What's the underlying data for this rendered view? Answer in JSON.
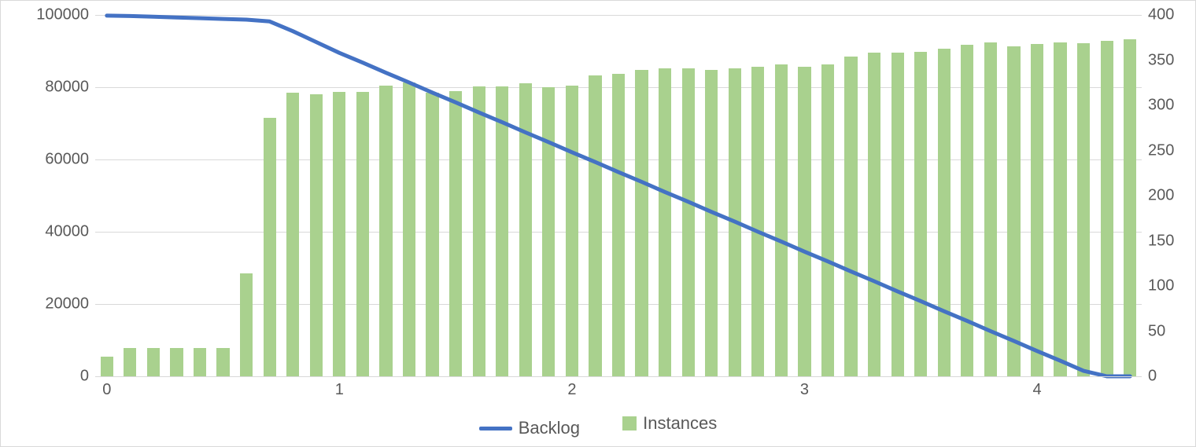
{
  "chart_data": {
    "type": "bar+line",
    "x": [
      0.0,
      0.1,
      0.2,
      0.3,
      0.4,
      0.5,
      0.6,
      0.7,
      0.8,
      0.9,
      1.0,
      1.1,
      1.2,
      1.3,
      1.4,
      1.5,
      1.6,
      1.7,
      1.8,
      1.9,
      2.0,
      2.1,
      2.2,
      2.3,
      2.4,
      2.5,
      2.6,
      2.7,
      2.8,
      2.9,
      3.0,
      3.1,
      3.2,
      3.3,
      3.4,
      3.5,
      3.6,
      3.7,
      3.8,
      3.9,
      4.0,
      4.1,
      4.2,
      4.3,
      4.4
    ],
    "series": [
      {
        "name": "Instances",
        "axis": "right",
        "type": "bar",
        "color": "#a9d18e",
        "values": [
          22,
          31,
          31,
          31,
          31,
          31,
          114,
          286,
          314,
          312,
          315,
          315,
          322,
          325,
          314,
          316,
          321,
          321,
          324,
          320,
          322,
          333,
          335,
          339,
          341,
          341,
          339,
          341,
          343,
          345,
          343,
          345,
          354,
          358,
          358,
          359,
          363,
          367,
          370,
          365,
          368,
          370,
          369,
          371,
          373,
          374,
          374
        ]
      },
      {
        "name": "Backlog",
        "axis": "left",
        "type": "line",
        "color": "#4472c4",
        "values": [
          99800,
          99700,
          99500,
          99300,
          99100,
          98900,
          98700,
          98200,
          95500,
          92500,
          89500,
          86800,
          84000,
          81300,
          78500,
          75800,
          73000,
          70300,
          67500,
          64800,
          62000,
          59300,
          56500,
          53800,
          51000,
          48300,
          45500,
          42800,
          40000,
          37300,
          34500,
          31800,
          29000,
          26300,
          23500,
          20800,
          18000,
          15300,
          12500,
          9800,
          7000,
          4300,
          1500,
          0,
          0
        ]
      }
    ],
    "y_left": {
      "min": 0,
      "max": 100000,
      "ticks": [
        0,
        20000,
        40000,
        60000,
        80000,
        100000
      ]
    },
    "y_right": {
      "min": 0,
      "max": 400,
      "ticks": [
        0,
        50,
        100,
        150,
        200,
        250,
        300,
        350,
        400
      ]
    },
    "x_axis": {
      "min": 0,
      "max": 4.4,
      "ticks": [
        0,
        1,
        2,
        3,
        4
      ]
    },
    "legend": {
      "backlog_label": "Backlog",
      "instances_label": "Instances"
    },
    "grid": true
  }
}
